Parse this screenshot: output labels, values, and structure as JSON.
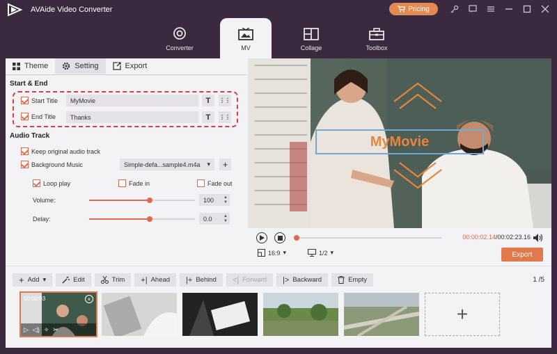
{
  "app": {
    "title": "AVAide Video Converter",
    "pricing": "Pricing"
  },
  "top_tabs": [
    {
      "label": "Converter",
      "icon": "converter-icon"
    },
    {
      "label": "MV",
      "icon": "mv-icon"
    },
    {
      "label": "Collage",
      "icon": "collage-icon"
    },
    {
      "label": "Toolbox",
      "icon": "toolbox-icon"
    }
  ],
  "subtabs": {
    "theme": "Theme",
    "setting": "Setting",
    "export": "Export"
  },
  "start_end": {
    "heading": "Start & End",
    "start_label": "Start Title",
    "start_value": "MyMovie",
    "end_label": "End Title",
    "end_value": "Thanks"
  },
  "audio": {
    "heading": "Audio Track",
    "keep_original": "Keep original audio track",
    "background_music": "Background Music",
    "music_file": "Simple-defa...sample4.m4a",
    "loop_play": "Loop play",
    "fade_in": "Fade in",
    "fade_out": "Fade out",
    "volume_label": "Volume:",
    "volume_value": "100",
    "volume_level": 0.57,
    "delay_label": "Delay:",
    "delay_value": "0.0",
    "delay_level": 0.57
  },
  "preview": {
    "overlay_title": "MyMovie",
    "time_current": "00:00:02.14",
    "time_total": "/00:02:23.16",
    "progress": 0.01,
    "ratio": "16:9",
    "page_select": "1/2",
    "export": "Export"
  },
  "toolbar": {
    "add": "Add",
    "edit": "Edit",
    "trim": "Trim",
    "ahead": "Ahead",
    "behind": "Behind",
    "forward": "Forward",
    "backward": "Backward",
    "empty": "Empty",
    "page_count": "1 /5"
  },
  "thumb_duration": "00:00:03",
  "colors": {
    "accent": "#e0794b",
    "titlebar": "#3b2a3f"
  }
}
